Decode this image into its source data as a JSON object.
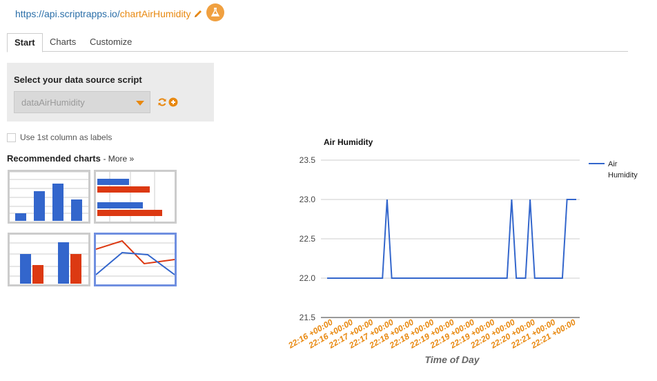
{
  "header": {
    "url_base": "https://api.scriptrapps.io/",
    "url_name": "chartAirHumidity"
  },
  "tabs": [
    {
      "label": "Start",
      "active": true
    },
    {
      "label": "Charts",
      "active": false
    },
    {
      "label": "Customize",
      "active": false
    }
  ],
  "datasource": {
    "title": "Select your data source script",
    "selected": "dataAirHumidity"
  },
  "options": {
    "use_first_column_label": "Use 1st column as labels",
    "use_first_column_checked": false
  },
  "recommended": {
    "title": "Recommended charts",
    "more_label": "- More »"
  },
  "colors": {
    "accent": "#e8880f",
    "link": "#2a6ea8",
    "series_blue": "#3366cc",
    "series_red": "#dc3912"
  },
  "chart_data": {
    "type": "line",
    "title": "Air Humidity",
    "xlabel": "Time of Day",
    "ylabel": "",
    "ylim": [
      21.5,
      23.5
    ],
    "yticks": [
      "21.5",
      "22.0",
      "22.5",
      "23.0",
      "23.5"
    ],
    "xtick_labels": [
      "22:16 +00:00",
      "22:16 +00:00",
      "22:17 +00:00",
      "22:17 +00:00",
      "22:18 +00:00",
      "22:18 +00:00",
      "22:19 +00:00",
      "22:19 +00:00",
      "22:19 +00:00",
      "22:20 +00:00",
      "22:20 +00:00",
      "22:21 +00:00",
      "22:21 +00:00"
    ],
    "legend_position": "right",
    "series": [
      {
        "name": "Air Humidity",
        "color": "#3366cc",
        "values": [
          22,
          22,
          22,
          22,
          22,
          22,
          22,
          22,
          22,
          22,
          22,
          22,
          22,
          23,
          22,
          22,
          22,
          22,
          22,
          22,
          22,
          22,
          22,
          22,
          22,
          22,
          22,
          22,
          22,
          22,
          22,
          22,
          22,
          22,
          22,
          22,
          22,
          22,
          22,
          22,
          23,
          22,
          22,
          22,
          23,
          22,
          22,
          22,
          22,
          22,
          22,
          22,
          23,
          23,
          23
        ]
      }
    ]
  }
}
